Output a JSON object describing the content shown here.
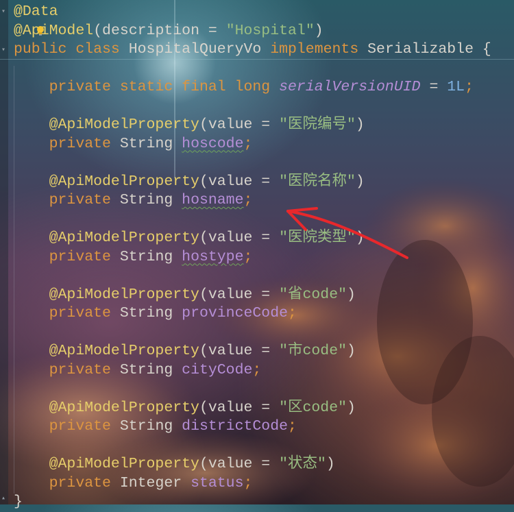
{
  "editor": {
    "lines": [
      {
        "annotation": "@Data"
      },
      {
        "annotation_prefix": "@Ap",
        "annotation_rest": "iModel",
        "open": "(",
        "param": "description",
        "eq": " = ",
        "value": "\"Hospital\"",
        "close": ")"
      },
      {
        "kw1": "public",
        "kw2": "class",
        "name": "HospitalQueryVo",
        "kw3": "implements",
        "iface": "Serializable",
        "brace": "{"
      },
      {},
      {
        "kw1": "private",
        "kw2": "static",
        "kw3": "final",
        "kw4": "long",
        "field": "serialVersionUID",
        "eq": " = ",
        "num": "1L",
        "end": ";"
      },
      {},
      {
        "annotation": "@ApiModelProperty",
        "open": "(",
        "param": "value",
        "eq": " = ",
        "value": "\"医院编号\"",
        "close": ")"
      },
      {
        "kw": "private",
        "type": "String",
        "field": "hoscode",
        "end": ";"
      },
      {},
      {
        "annotation": "@ApiModelProperty",
        "open": "(",
        "param": "value",
        "eq": " = ",
        "value": "\"医院名称\"",
        "close": ")"
      },
      {
        "kw": "private",
        "type": "String",
        "field": "hosname",
        "end": ";"
      },
      {},
      {
        "annotation": "@ApiModelProperty",
        "open": "(",
        "param": "value",
        "eq": " = ",
        "value": "\"医院类型\"",
        "close": ")"
      },
      {
        "kw": "private",
        "type": "String",
        "field": "hostype",
        "end": ";"
      },
      {},
      {
        "annotation": "@ApiModelProperty",
        "open": "(",
        "param": "value",
        "eq": " = ",
        "value": "\"省code\"",
        "close": ")"
      },
      {
        "kw": "private",
        "type": "String",
        "field": "provinceCode",
        "end": ";"
      },
      {},
      {
        "annotation": "@ApiModelProperty",
        "open": "(",
        "param": "value",
        "eq": " = ",
        "value": "\"市code\"",
        "close": ")"
      },
      {
        "kw": "private",
        "type": "String",
        "field": "cityCode",
        "end": ";"
      },
      {},
      {
        "annotation": "@ApiModelProperty",
        "open": "(",
        "param": "value",
        "eq": " = ",
        "value": "\"区code\"",
        "close": ")"
      },
      {
        "kw": "private",
        "type": "String",
        "field": "districtCode",
        "end": ";"
      },
      {},
      {
        "annotation": "@ApiModelProperty",
        "open": "(",
        "param": "value",
        "eq": " = ",
        "value": "\"状态\"",
        "close": ")"
      },
      {
        "kw": "private",
        "type": "Integer",
        "field": "status",
        "end": ";"
      },
      {
        "brace": "}"
      }
    ]
  },
  "icons": {
    "intention_bulb": "lightbulb-icon",
    "annotation_arrow": "red-arrow-annotation"
  },
  "colors": {
    "annotation": "#e6ce6a",
    "keyword": "#dd9540",
    "string": "#99be82",
    "field": "#b58ed6",
    "plain": "#d8d4cc",
    "number": "#7fb1e0",
    "arrow": "#e8282c"
  }
}
